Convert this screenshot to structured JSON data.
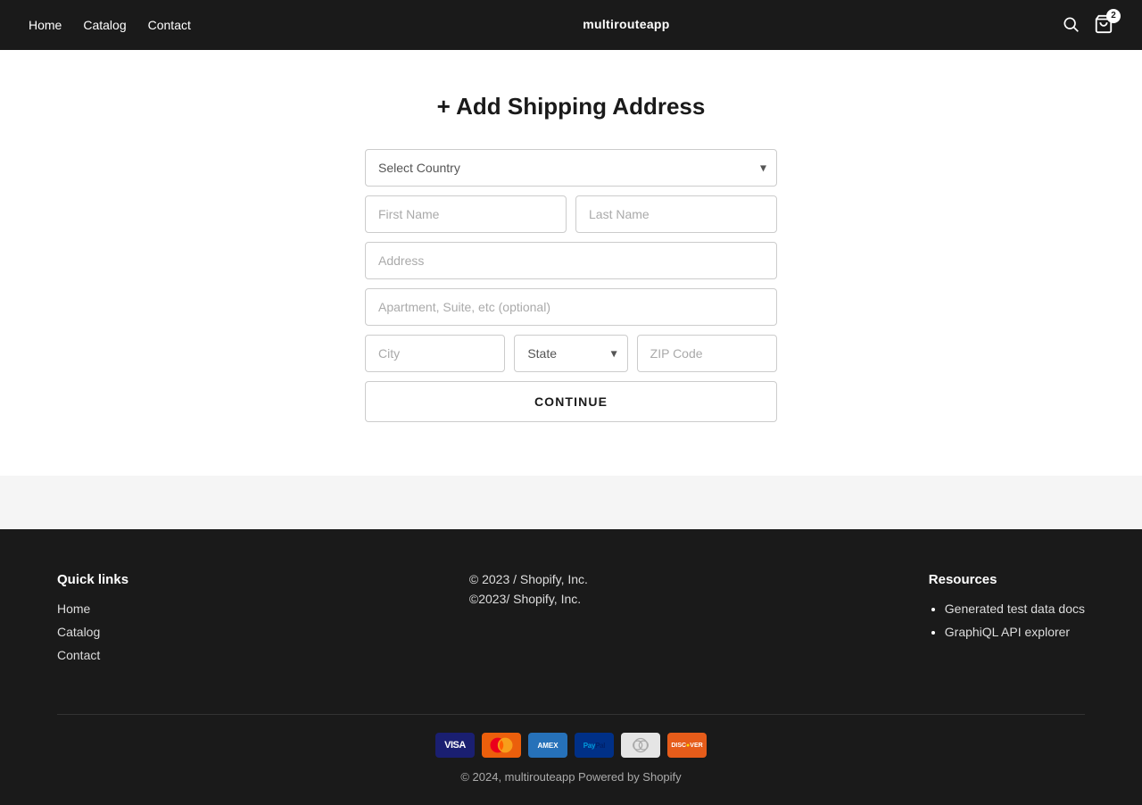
{
  "nav": {
    "brand": "multirouteapp",
    "links": [
      {
        "label": "Home",
        "href": "#"
      },
      {
        "label": "Catalog",
        "href": "#"
      },
      {
        "label": "Contact",
        "href": "#"
      }
    ],
    "cart_count": "2"
  },
  "page": {
    "title": "+ Add Shipping Address"
  },
  "form": {
    "country_placeholder": "Select Country",
    "first_name_placeholder": "First Name",
    "last_name_placeholder": "Last Name",
    "address_placeholder": "Address",
    "apartment_placeholder": "Apartment, Suite, etc (optional)",
    "city_placeholder": "City",
    "state_placeholder": "State",
    "zip_placeholder": "ZIP Code",
    "continue_label": "CONTINUE"
  },
  "footer": {
    "quick_links_heading": "Quick links",
    "quick_links": [
      {
        "label": "Home",
        "href": "#"
      },
      {
        "label": "Catalog",
        "href": "#"
      },
      {
        "label": "Contact",
        "href": "#"
      }
    ],
    "copyright_center": "© 2023 / Shopify, Inc.",
    "copyright_center2": "©2023/ Shopify, Inc.",
    "resources_heading": "Resources",
    "resources": [
      {
        "label": "Generated test data docs",
        "href": "#"
      },
      {
        "label": "GraphiQL API explorer",
        "href": "#"
      }
    ],
    "bottom_copyright": "© 2024, multirouteapp Powered by Shopify",
    "payment_methods": [
      {
        "name": "Visa",
        "class": "visa-card",
        "label": "VISA"
      },
      {
        "name": "Mastercard",
        "class": "mc-card",
        "label": "MC"
      },
      {
        "name": "American Express",
        "class": "amex-card",
        "label": "AMEX"
      },
      {
        "name": "PayPal",
        "class": "paypal-card",
        "label": "PayPal"
      },
      {
        "name": "Diners Club",
        "class": "diners-card",
        "label": "Diners"
      },
      {
        "name": "Discover",
        "class": "discover-card",
        "label": "DISCOVER"
      }
    ]
  }
}
